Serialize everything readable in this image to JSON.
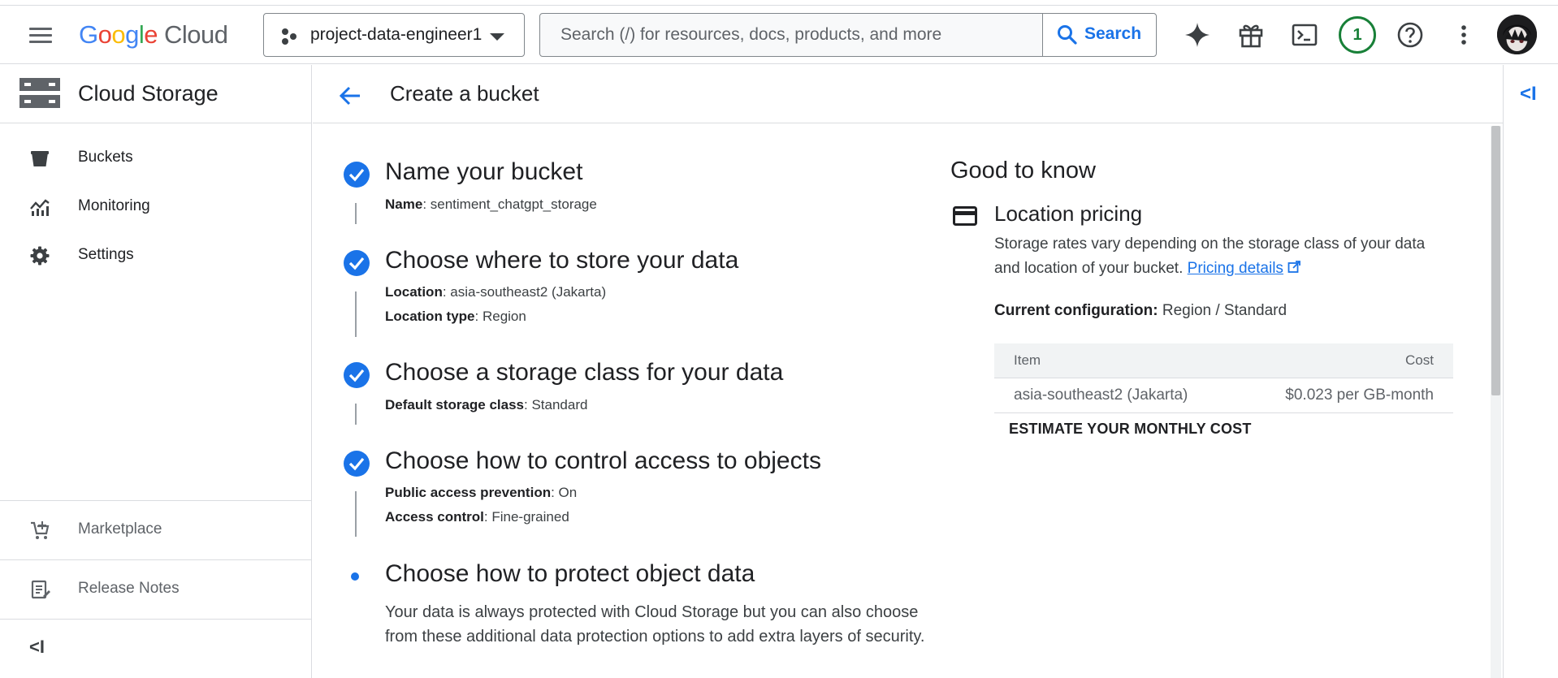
{
  "header": {
    "logo_google": [
      "G",
      "o",
      "o",
      "g",
      "l",
      "e"
    ],
    "logo_cloud": "Cloud",
    "project_name": "project-data-engineer1",
    "search_placeholder": "Search (/) for resources, docs, products, and more",
    "search_button": "Search",
    "notification_count": "1",
    "icons": [
      "menu-icon",
      "gemini-sparkle-icon",
      "gift-icon",
      "cloud-shell-icon",
      "help-icon",
      "more-vert-icon"
    ]
  },
  "sidenav": {
    "product_title": "Cloud Storage",
    "items": [
      {
        "label": "Buckets",
        "icon": "bucket-icon"
      },
      {
        "label": "Monitoring",
        "icon": "monitoring-icon"
      },
      {
        "label": "Settings",
        "icon": "gear-icon"
      }
    ],
    "footer_items": [
      {
        "label": "Marketplace",
        "icon": "cart-icon"
      },
      {
        "label": "Release Notes",
        "icon": "release-notes-icon"
      }
    ],
    "collapse_label": "<I"
  },
  "page": {
    "title": "Create a bucket"
  },
  "steps": [
    {
      "title": "Name your bucket",
      "details": [
        {
          "key": "Name",
          "value": ": sentiment_chatgpt_storage"
        }
      ]
    },
    {
      "title": "Choose where to store your data",
      "details": [
        {
          "key": "Location",
          "value": ": asia-southeast2 (Jakarta)"
        },
        {
          "key": "Location type",
          "value": ": Region"
        }
      ]
    },
    {
      "title": "Choose a storage class for your data",
      "details": [
        {
          "key": "Default storage class",
          "value": ": Standard"
        }
      ]
    },
    {
      "title": "Choose how to control access to objects",
      "details": [
        {
          "key": "Public access prevention",
          "value": ": On"
        },
        {
          "key": "Access control",
          "value": ": Fine-grained"
        }
      ]
    },
    {
      "title": "Choose how to protect object data",
      "description": "Your data is always protected with Cloud Storage but you can also choose from these additional data protection options to add extra layers of security."
    }
  ],
  "good_to_know": {
    "title": "Good to know",
    "subtitle": "Location pricing",
    "body": "Storage rates vary depending on the storage class of your data and location of your bucket. ",
    "link": "Pricing details",
    "config_label": "Current configuration:",
    "config_value": " Region / Standard",
    "table": {
      "headers": [
        "Item",
        "Cost"
      ],
      "rows": [
        [
          "asia-southeast2 (Jakarta)",
          "$0.023 per GB-month"
        ]
      ]
    },
    "estimate_button": "ESTIMATE YOUR MONTHLY COST"
  },
  "right_rail": {
    "collapse_label": "<I"
  },
  "colors": {
    "accent": "#1a73e8",
    "badge": "#188038",
    "border": "#dadce0"
  }
}
